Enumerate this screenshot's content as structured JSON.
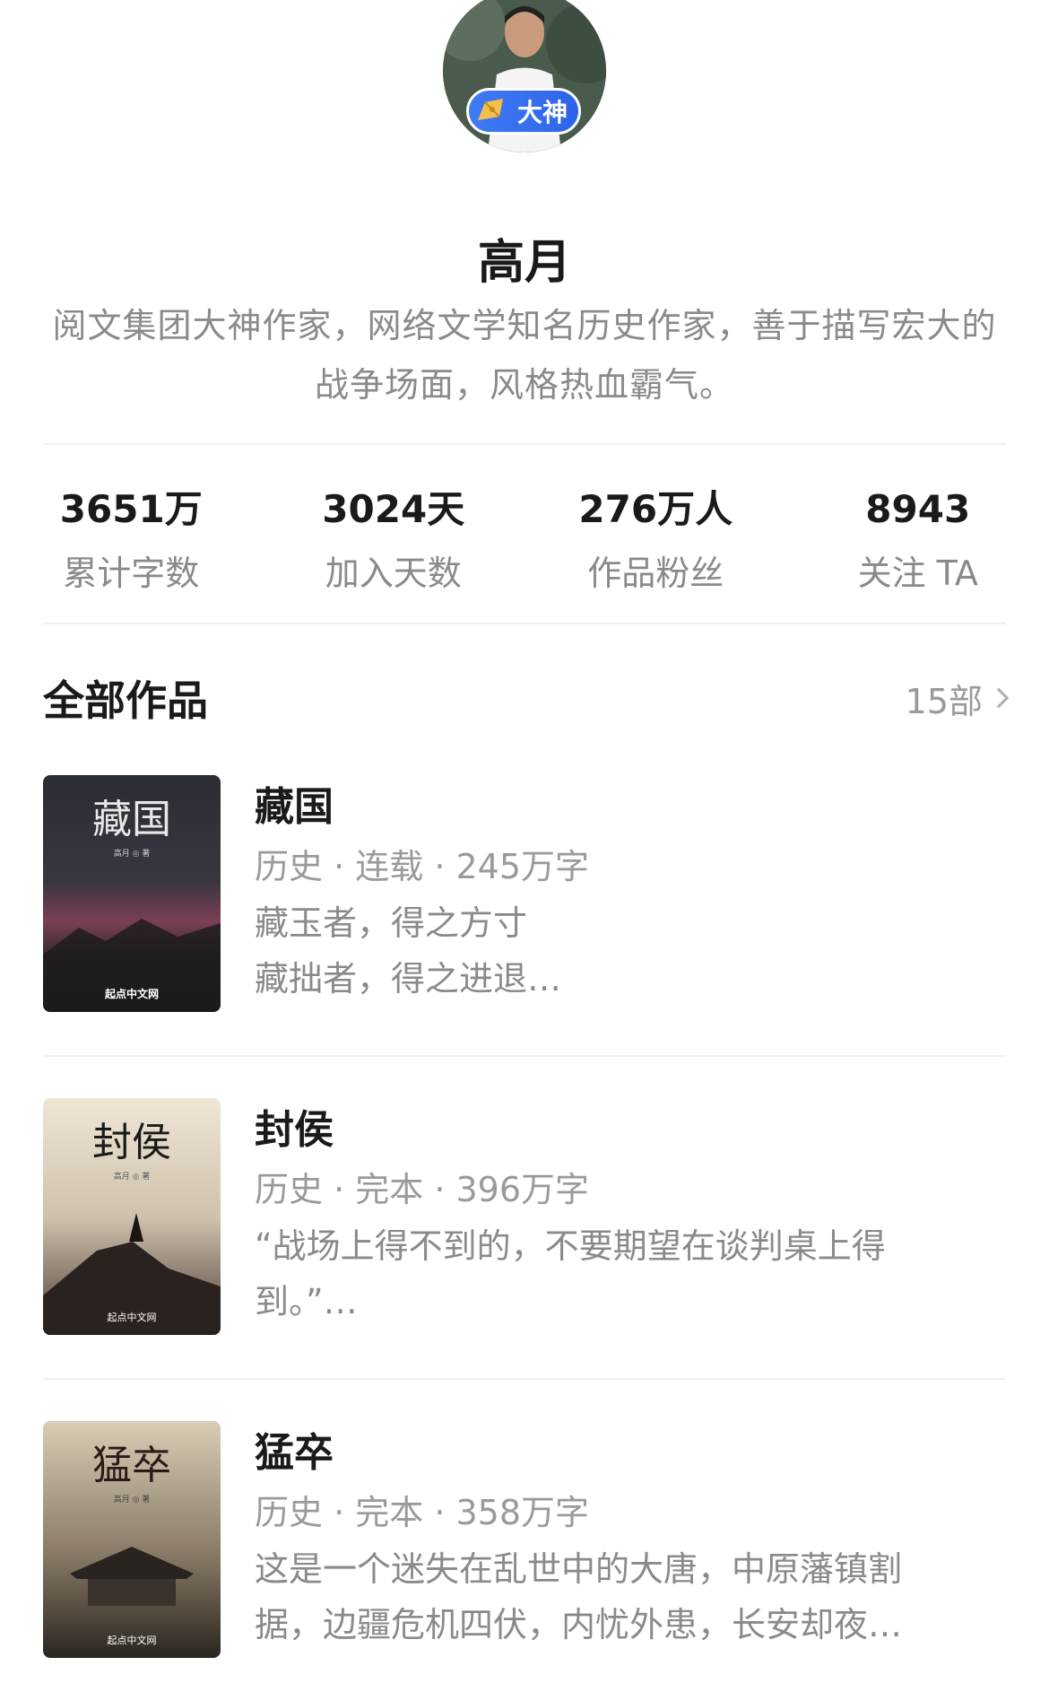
{
  "profile": {
    "badge": "大神",
    "name": "高月",
    "bio": "阅文集团大神作家，网络文学知名历史作家，善于描写宏大的战争场面，风格热血霸气。"
  },
  "stats": [
    {
      "value": "3651万",
      "label": "累计字数"
    },
    {
      "value": "3024天",
      "label": "加入天数"
    },
    {
      "value": "276万人",
      "label": "作品粉丝"
    },
    {
      "value": "8943",
      "label": "关注 TA"
    }
  ],
  "works": {
    "title": "全部作品",
    "count": "15部"
  },
  "books": [
    {
      "title": "藏国",
      "meta": "历史 · 连载 · 245万字",
      "desc_line1": "藏玉者，得之方寸",
      "desc_line2": "藏拙者，得之进退…",
      "cover_title": "藏国",
      "cover_author": "高月 ◎ 著",
      "cover_publisher": "起点中文网"
    },
    {
      "title": "封侯",
      "meta": "历史 · 完本 · 396万字",
      "desc_line1": "“战场上得不到的，不要期望在谈判桌上得",
      "desc_line2": "到。”…",
      "cover_title": "封侯",
      "cover_author": "高月 ◎ 著",
      "cover_publisher": "起点中文网"
    },
    {
      "title": "猛卒",
      "meta": "历史 · 完本 · 358万字",
      "desc_line1": "这是一个迷失在乱世中的大唐，中原藩镇割",
      "desc_line2": "据，边疆危机四伏，内忧外患，长安却夜…",
      "cover_title": "猛卒",
      "cover_author": "高月 ◎ 著",
      "cover_publisher": "起点中文网"
    }
  ]
}
